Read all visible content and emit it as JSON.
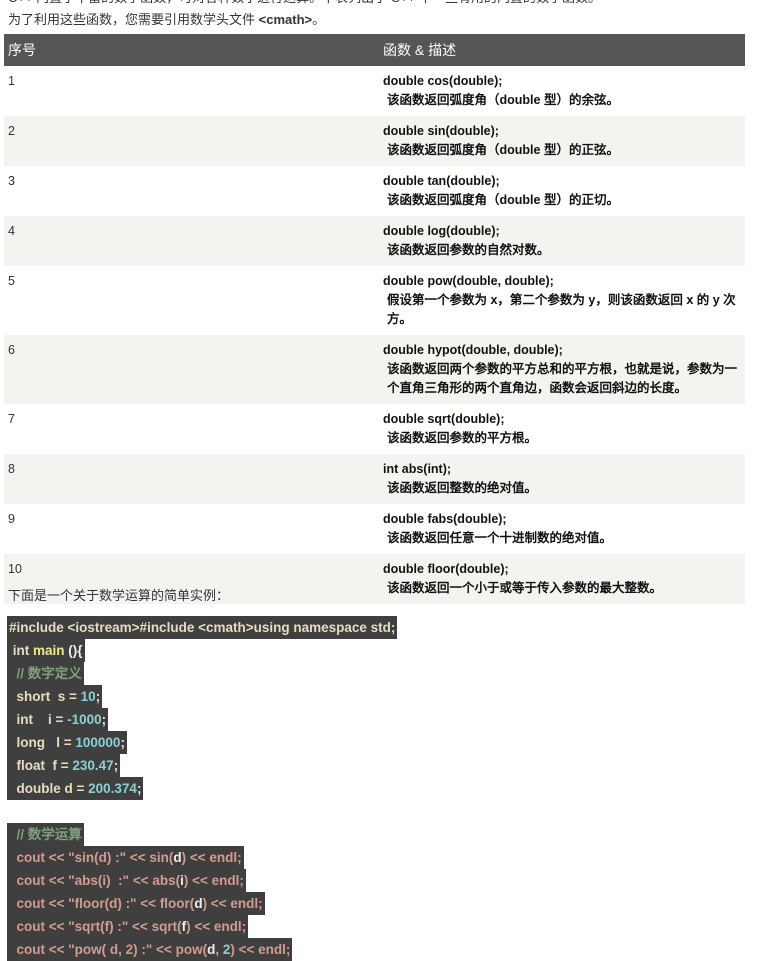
{
  "intro": {
    "line0": "C++ 内置了丰富的数学函数，可对各种数字进行运算。下表列出了 C++ 中一些有用的内置的数学函数。",
    "line1_prefix": "为了利用这些函数，您需要引用数学头文件 ",
    "line1_header": "<cmath>",
    "line1_suffix": "。"
  },
  "table": {
    "headers": [
      "序号",
      "函数 & 描述"
    ],
    "rows": [
      {
        "n": "1",
        "fn": "double cos(double);",
        "desc": "该函数返回弧度角（double 型）的余弦。"
      },
      {
        "n": "2",
        "fn": "double sin(double);",
        "desc": "该函数返回弧度角（double 型）的正弦。"
      },
      {
        "n": "3",
        "fn": "double tan(double);",
        "desc": "该函数返回弧度角（double 型）的正切。"
      },
      {
        "n": "4",
        "fn": "double log(double);",
        "desc": "该函数返回参数的自然对数。"
      },
      {
        "n": "5",
        "fn": "double pow(double, double);",
        "desc": "假设第一个参数为 x，第二个参数为 y，则该函数返回 x 的 y 次方。"
      },
      {
        "n": "6",
        "fn": "double hypot(double, double);",
        "desc": "该函数返回两个参数的平方总和的平方根，也就是说，参数为一个直角三角形的两个直角边，函数会返回斜边的长度。"
      },
      {
        "n": "7",
        "fn": "double sqrt(double);",
        "desc": "该函数返回参数的平方根。"
      },
      {
        "n": "8",
        "fn": "int abs(int);",
        "desc": "该函数返回整数的绝对值。"
      },
      {
        "n": "9",
        "fn": "double fabs(double);",
        "desc": "该函数返回任意一个十进制数的绝对值。"
      },
      {
        "n": "10",
        "fn": "double floor(double);",
        "desc": "该函数返回一个小于或等于传入参数的最大整数。"
      }
    ]
  },
  "example_intro": "下面是一个关于数学运算的简单实例：",
  "code": {
    "l0": "#include <iostream>#include <cmath>using namespace std;",
    "l1a": " int ",
    "l1b": "main",
    "l1c": " (){",
    "l2": "  // 数字定义",
    "l3a": "  short  s = ",
    "l3b": "10",
    "l3c": ";",
    "l4a": "  int    i = ",
    "l4b": "-1000",
    "l4c": ";",
    "l5a": "  long   l = ",
    "l5b": "100000",
    "l5c": ";",
    "l6a": "  float  f = ",
    "l6b": "230.47",
    "l6c": ";",
    "l7a": "  double d = ",
    "l7b": "200.374",
    "l7c": ";",
    "l9": "  // 数学运算",
    "c1a": "  cout << \"sin(d) :\" << sin(",
    "c1b": "d",
    "c1c": ") << endl;",
    "c2a": "  cout << \"abs(i)  :\" << abs(",
    "c2b": "i",
    "c2c": ") << endl;",
    "c3a": "  cout << \"floor(d) :\" << floor(",
    "c3b": "d",
    "c3c": ") << endl;",
    "c4a": "  cout << \"sqrt(f) :\" << sqrt(",
    "c4b": "f",
    "c4c": ") << endl;",
    "c5a": "  cout << \"pow( d, 2) :\" << pow(",
    "c5b": "d",
    "c5c": ", ",
    "c5d": "2",
    "c5e": ") << endl;"
  }
}
